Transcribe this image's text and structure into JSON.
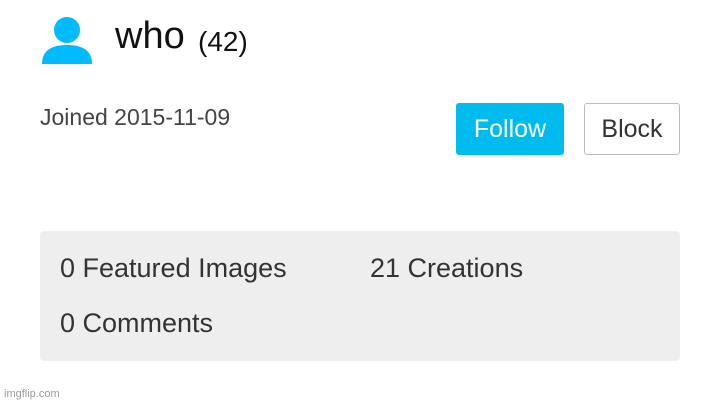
{
  "profile": {
    "username": "who",
    "points": "(42)",
    "joined": "Joined 2015-11-09",
    "avatar_icon": "user-icon",
    "avatar_color": "#00bbff"
  },
  "actions": {
    "follow_label": "Follow",
    "block_label": "Block",
    "follow_color": "#00bbee"
  },
  "stats": {
    "featured_images": "0 Featured Images",
    "creations": "21 Creations",
    "comments": "0 Comments"
  },
  "watermark": "imgflip.com"
}
